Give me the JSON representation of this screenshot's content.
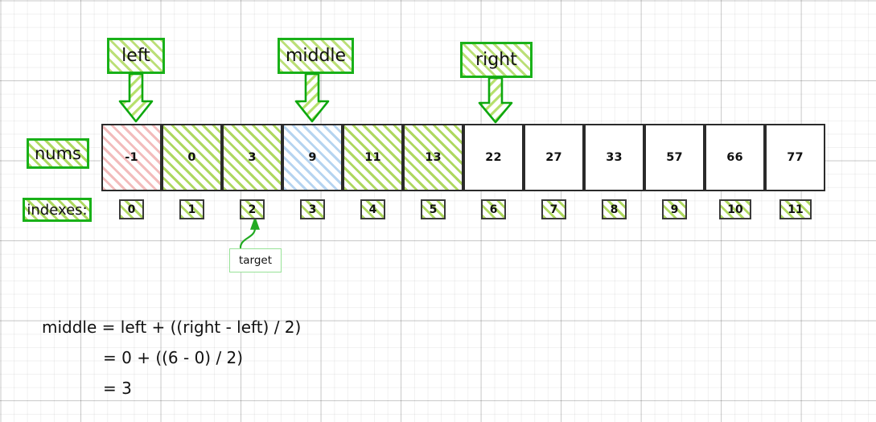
{
  "diagram": {
    "title": "binary-search-middle-calculation",
    "colors": {
      "accent_green": "#19b119",
      "hatch_green": "#aed860",
      "hatch_pink": "#f2bcbc",
      "hatch_blue": "#b6d4f0",
      "cell_border": "#2b2b2b",
      "target_border": "#97e297"
    }
  },
  "labels": {
    "nums": "nums",
    "indexes": "indexes:",
    "left": "left",
    "middle": "middle",
    "right": "right",
    "target": "target"
  },
  "array": {
    "values": [
      "-1",
      "0",
      "3",
      "9",
      "11",
      "13",
      "22",
      "27",
      "33",
      "57",
      "66",
      "77"
    ],
    "fills": [
      "pink",
      "green",
      "green",
      "blue",
      "green",
      "green",
      "none",
      "none",
      "none",
      "none",
      "none",
      "none"
    ]
  },
  "indexes": {
    "values": [
      "0",
      "1",
      "2",
      "3",
      "4",
      "5",
      "6",
      "7",
      "8",
      "9",
      "10",
      "11"
    ]
  },
  "pointers": {
    "left_index": "0",
    "middle_index": "3",
    "right_index": "6",
    "target_index": "2"
  },
  "formula": {
    "line1": "middle = left + ((right - left) / 2)",
    "line2": "= 0 + ((6 - 0) / 2)",
    "line3": "= 3"
  }
}
